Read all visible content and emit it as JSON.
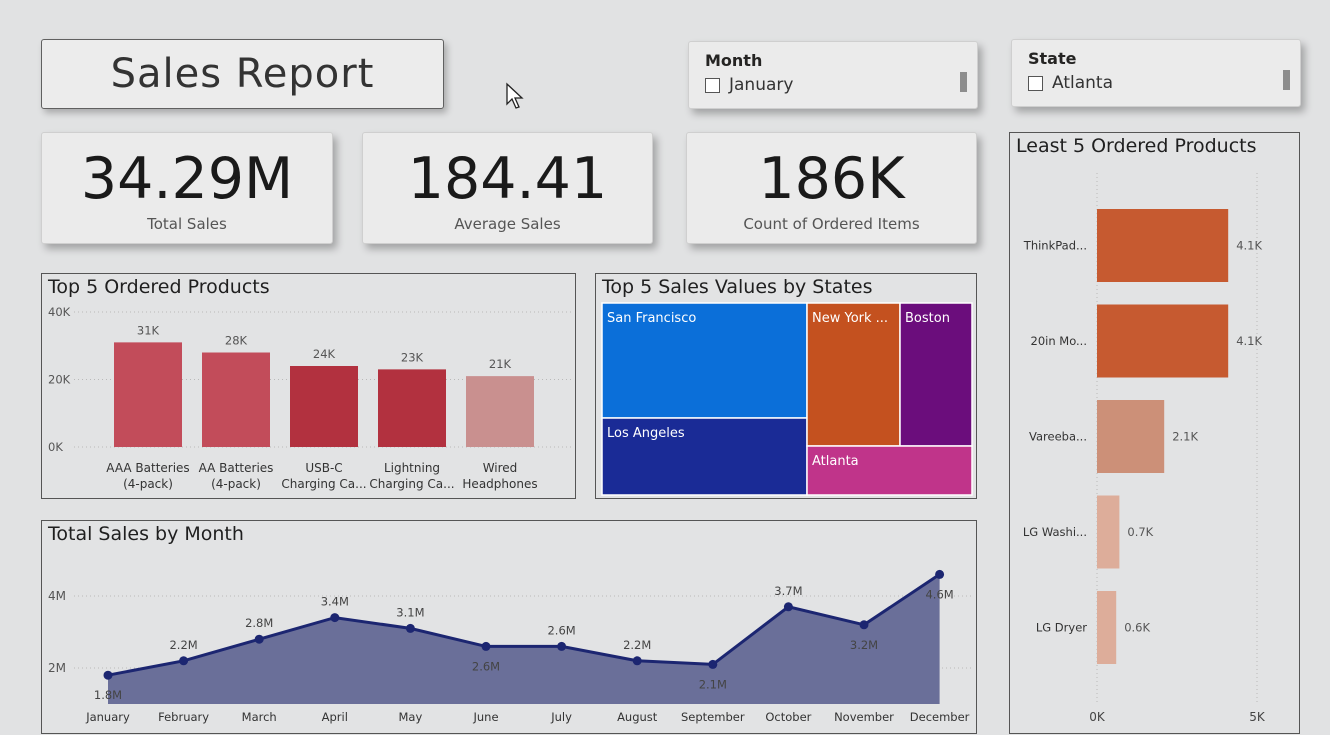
{
  "report_title": "Sales Report",
  "slicers": {
    "month": {
      "label": "Month",
      "option": "January"
    },
    "state": {
      "label": "State",
      "option": "Atlanta"
    }
  },
  "kpis": {
    "total_sales": {
      "value": "34.29M",
      "label": "Total Sales"
    },
    "average_sales": {
      "value": "184.41",
      "label": "Average Sales"
    },
    "ordered_items": {
      "value": "186K",
      "label": "Count of Ordered Items"
    }
  },
  "top_products": {
    "title": "Top 5 Ordered Products",
    "y_ticks": [
      "40K",
      "20K",
      "0K"
    ],
    "bar_colors": [
      "#c24c5a",
      "#c24c5a",
      "#b2313f",
      "#b2313f",
      "#c9908f"
    ]
  },
  "treemap": {
    "title": "Top 5 Sales Values by States",
    "tiles": [
      {
        "label": "San Francisco",
        "color": "#0b6fd9"
      },
      {
        "label": "Los Angeles",
        "color": "#1a2b96"
      },
      {
        "label": "New York ...",
        "color": "#c4511f"
      },
      {
        "label": "Boston",
        "color": "#6b0d7c"
      },
      {
        "label": "Atlanta",
        "color": "#c0348a"
      }
    ]
  },
  "monthly": {
    "title": "Total Sales by Month",
    "y_ticks": [
      "4M",
      "2M"
    ],
    "line_color": "#1c2671",
    "area_color": "#6a6f99"
  },
  "least_products": {
    "title": "Least 5 Ordered Products",
    "x_ticks": [
      "0K",
      "5K"
    ]
  },
  "chart_data": [
    {
      "type": "bar",
      "title": "Top 5 Ordered Products",
      "categories": [
        [
          "AAA Batteries",
          "(4-pack)"
        ],
        [
          "AA Batteries",
          "(4-pack)"
        ],
        [
          "USB-C",
          "Charging Ca..."
        ],
        [
          "Lightning",
          "Charging Ca..."
        ],
        [
          "Wired",
          "Headphones"
        ]
      ],
      "values": [
        31000,
        28000,
        24000,
        23000,
        21000
      ],
      "data_labels": [
        "31K",
        "28K",
        "24K",
        "23K",
        "21K"
      ],
      "ylim": [
        0,
        40000
      ]
    },
    {
      "type": "area",
      "title": "Total Sales by Month",
      "categories": [
        "January",
        "February",
        "March",
        "April",
        "May",
        "June",
        "July",
        "August",
        "September",
        "October",
        "November",
        "December"
      ],
      "values": [
        1.8,
        2.2,
        2.8,
        3.4,
        3.1,
        2.6,
        2.6,
        2.2,
        2.1,
        3.7,
        3.2,
        4.6
      ],
      "data_labels": [
        "1.8M",
        "2.2M",
        "2.8M",
        "3.4M",
        "3.1M",
        "2.6M",
        "2.6M",
        "2.2M",
        "2.1M",
        "3.7M",
        "3.2M",
        "4.6M"
      ],
      "unit": "M"
    },
    {
      "type": "bar",
      "orientation": "horizontal",
      "title": "Least 5 Ordered Products",
      "categories": [
        "ThinkPad...",
        "20in Mo...",
        "Vareeba...",
        "LG Washi...",
        "LG Dryer"
      ],
      "values": [
        4100,
        4100,
        2100,
        700,
        600
      ],
      "data_labels": [
        "4.1K",
        "4.1K",
        "2.1K",
        "0.7K",
        "0.6K"
      ],
      "colors": [
        "#c65a30",
        "#c65a30",
        "#cc9078",
        "#ddad9a",
        "#ddad9a"
      ],
      "xlim": [
        0,
        5000
      ]
    },
    {
      "type": "treemap",
      "title": "Top 5 Sales Values by States",
      "categories": [
        "San Francisco",
        "Los Angeles",
        "New York ...",
        "Boston",
        "Atlanta"
      ]
    }
  ]
}
